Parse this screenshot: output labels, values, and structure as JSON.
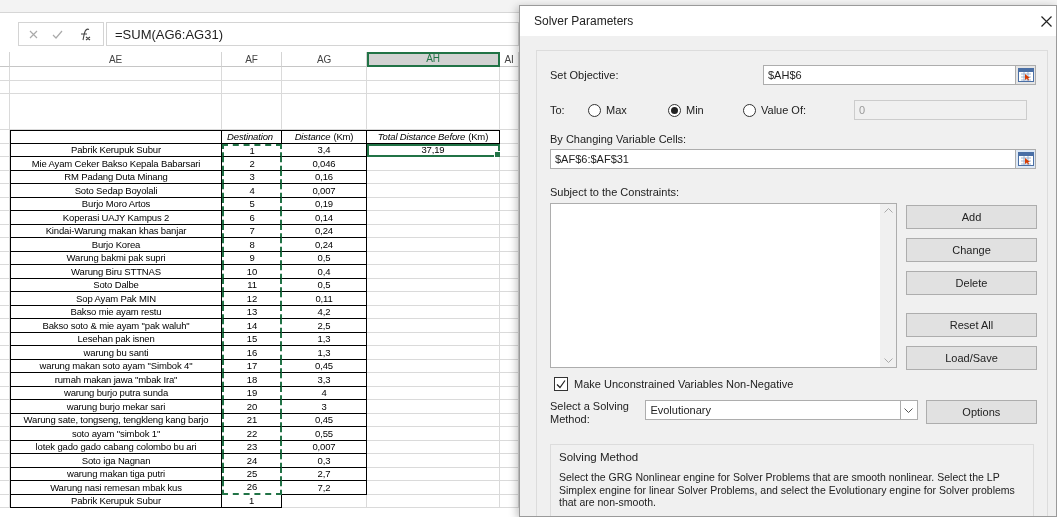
{
  "formula_bar": {
    "formula": "=SUM(AG6:AG31)"
  },
  "sheet": {
    "columns": [
      {
        "label": "AE",
        "selected": false
      },
      {
        "label": "AF",
        "selected": false
      },
      {
        "label": "AG",
        "selected": false
      },
      {
        "label": "AH",
        "selected": true
      },
      {
        "label": "AI",
        "selected": false
      }
    ],
    "headers": [
      "*Destination*",
      "*Distance*  (Km)",
      "*Total Distance Before* (Km)"
    ],
    "rows": [
      {
        "name": "Pabrik Kerupuk Subur",
        "destination": "1",
        "distance": "3,4",
        "copied": true,
        "total": {
          "value": "37,19",
          "selected": true
        }
      },
      {
        "name": "Mie Ayam Ceker Bakso Kepala Babarsari",
        "destination": "2",
        "distance": "0,046",
        "copied": true
      },
      {
        "name": "RM Padang Duta Minang",
        "destination": "3",
        "distance": "0,16",
        "copied": true
      },
      {
        "name": "Soto Sedap Boyolali",
        "destination": "4",
        "distance": "0,007",
        "copied": true
      },
      {
        "name": "Burjo Moro Artos",
        "destination": "5",
        "distance": "0,19",
        "copied": true
      },
      {
        "name": "Koperasi UAJY Kampus 2",
        "destination": "6",
        "distance": "0,14",
        "copied": true
      },
      {
        "name": "Kindai-Warung makan khas banjar",
        "destination": "7",
        "distance": "0,24",
        "copied": true
      },
      {
        "name": "Burjo Korea",
        "destination": "8",
        "distance": "0,24",
        "copied": true
      },
      {
        "name": "Warung bakmi pak supri",
        "destination": "9",
        "distance": "0,5",
        "copied": true
      },
      {
        "name": "Warung Biru STTNAS",
        "destination": "10",
        "distance": "0,4",
        "copied": true
      },
      {
        "name": "Soto Dalbe",
        "destination": "11",
        "distance": "0,5",
        "copied": true
      },
      {
        "name": "Sop Ayam Pak MIN",
        "destination": "12",
        "distance": "0,11",
        "copied": true
      },
      {
        "name": "Bakso mie ayam restu",
        "destination": "13",
        "distance": "4,2",
        "copied": true
      },
      {
        "name": "Bakso soto & mie ayam \"pak waluh\"",
        "destination": "14",
        "distance": "2,5",
        "copied": true
      },
      {
        "name": "Lesehan pak isnen",
        "destination": "15",
        "distance": "1,3",
        "copied": true
      },
      {
        "name": "warung bu santi",
        "destination": "16",
        "distance": "1,3",
        "copied": true
      },
      {
        "name": "warung makan soto ayam \"Simbok 4\"",
        "destination": "17",
        "distance": "0,45",
        "copied": true
      },
      {
        "name": "rumah makan jawa \"mbak Ira\"",
        "destination": "18",
        "distance": "3,3",
        "copied": true
      },
      {
        "name": "warung burjo putra sunda",
        "destination": "19",
        "distance": "4",
        "copied": true
      },
      {
        "name": "warung burjo mekar sari",
        "destination": "20",
        "distance": "3",
        "copied": true
      },
      {
        "name": "Warung sate, tongseng, tengkleng kang barjo",
        "destination": "21",
        "distance": "0,45",
        "copied": true
      },
      {
        "name": "soto ayam \"simbok 1\"",
        "destination": "22",
        "distance": "0,55",
        "copied": true
      },
      {
        "name": "lotek gado gado cabang colombo bu ari",
        "destination": "23",
        "distance": "0,007",
        "copied": true
      },
      {
        "name": "Soto iga Nagnan",
        "destination": "24",
        "distance": "0,3",
        "copied": true
      },
      {
        "name": "warung makan tiga putri",
        "destination": "25",
        "distance": "2,7",
        "copied": true
      },
      {
        "name": "Warung nasi remesan mbak kus",
        "destination": "26",
        "distance": "7,2",
        "copied": true
      },
      {
        "name": "Pabrik Kerupuk Subur",
        "destination": "1",
        "copied": false
      }
    ]
  },
  "dialog": {
    "title": "Solver Parameters",
    "set_objective": {
      "label": "Set Objective:",
      "value": "$AH$6"
    },
    "to": {
      "label": "To:",
      "options": [
        {
          "label": "Max",
          "selected": false
        },
        {
          "label": "Min",
          "selected": true
        },
        {
          "label": "Value Of:",
          "selected": false
        }
      ],
      "value_of": "0"
    },
    "changing": {
      "label": "By Changing Variable Cells:",
      "value": "$AF$6:$AF$31"
    },
    "constraints": {
      "label": "Subject to the Constraints:"
    },
    "buttons": [
      "Add",
      "Change",
      "Delete",
      "Reset All",
      "Load/Save"
    ],
    "non_negative": {
      "label": "Make Unconstrained Variables Non-Negative",
      "checked": true
    },
    "method": {
      "label": "Select a Solving Method:",
      "value": "Evolutionary",
      "options_button": "Options"
    },
    "description": {
      "title": "Solving Method",
      "text": "Select the GRG Nonlinear engine for Solver Problems that are smooth nonlinear. Select the LP Simplex engine for linear Solver Problems, and select the Evolutionary engine for Solver problems that are non-smooth."
    }
  }
}
